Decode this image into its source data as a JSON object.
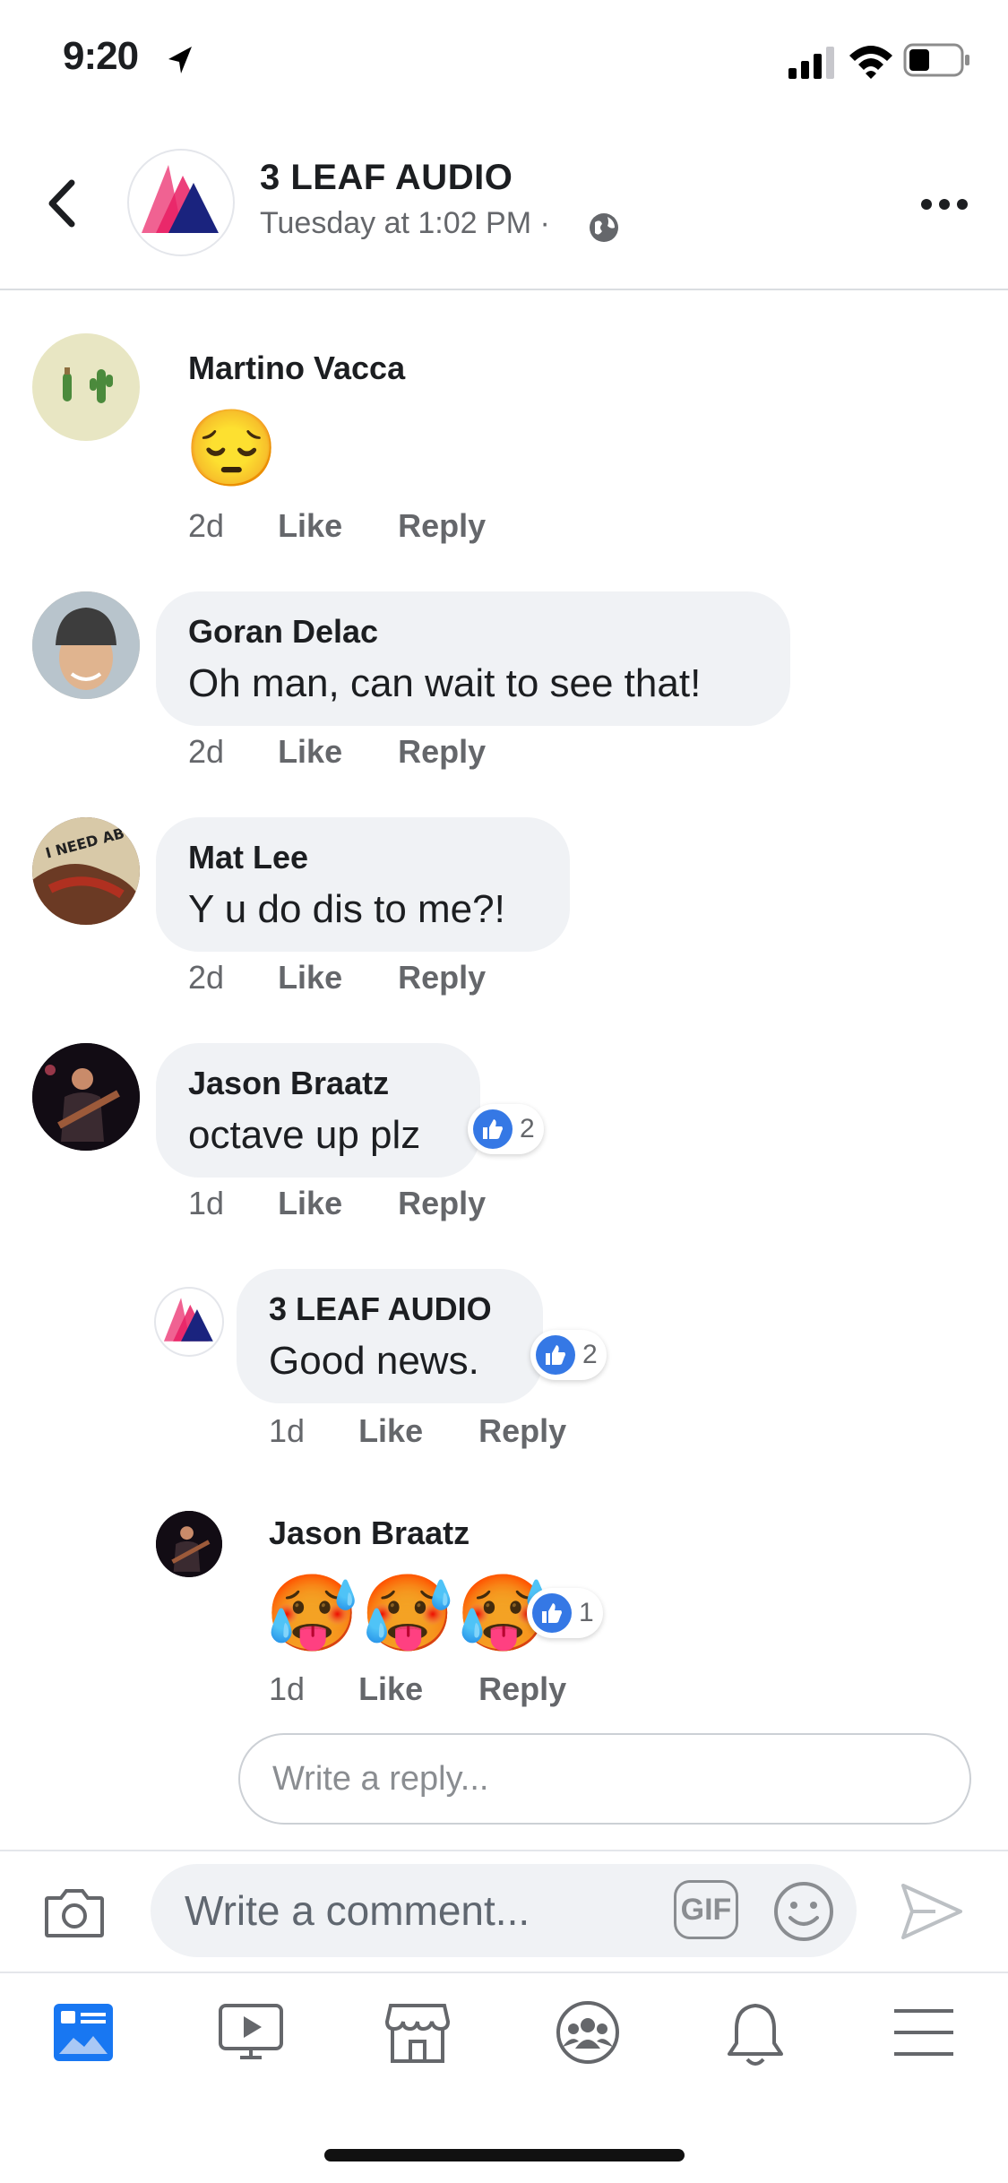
{
  "status_bar": {
    "time": "9:20"
  },
  "header": {
    "page_name": "3 LEAF AUDIO",
    "timestamp": "Tuesday at 1:02 PM",
    "separator": "·"
  },
  "comments": [
    {
      "author": "Martino Vacca",
      "text": "",
      "emoji": "😔",
      "age": "2d",
      "like": "Like",
      "reply": "Reply"
    },
    {
      "author": "Goran Delac",
      "text": "Oh man, can wait to see that!",
      "age": "2d",
      "like": "Like",
      "reply": "Reply"
    },
    {
      "author": "Mat Lee",
      "text": "Y u do dis to me?!",
      "age": "2d",
      "like": "Like",
      "reply": "Reply"
    },
    {
      "author": "Jason Braatz",
      "text": "octave up plz",
      "age": "1d",
      "like": "Like",
      "reply": "Reply",
      "reaction_count": "2"
    }
  ],
  "replies": [
    {
      "author": "3 LEAF AUDIO",
      "text": "Good news.",
      "age": "1d",
      "like": "Like",
      "reply": "Reply",
      "reaction_count": "2"
    },
    {
      "author": "Jason Braatz",
      "emoji": "🥵🥵🥵",
      "age": "1d",
      "like": "Like",
      "reply": "Reply",
      "reaction_count": "1"
    }
  ],
  "reply_box": {
    "placeholder": "Write a reply..."
  },
  "composer": {
    "placeholder": "Write a comment...",
    "gif_label": "GIF"
  },
  "tab_bar": {
    "items": [
      "news-feed",
      "watch",
      "marketplace",
      "groups",
      "notifications",
      "menu"
    ],
    "active": "news-feed"
  },
  "colors": {
    "accent": "#3578e5",
    "bubble": "#f0f2f5",
    "meta_text": "#65676b"
  }
}
